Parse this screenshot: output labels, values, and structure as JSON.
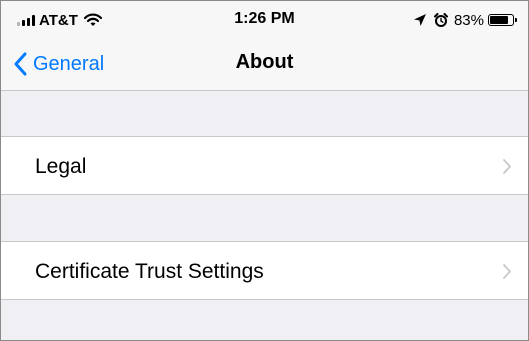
{
  "status_bar": {
    "carrier": "AT&T",
    "time": "1:26 PM",
    "battery_percent": "83%",
    "battery_level": 0.83,
    "icons": [
      "signal-icon",
      "wifi-icon",
      "location-arrow-icon",
      "alarm-icon",
      "battery-icon"
    ]
  },
  "nav": {
    "back_label": "General",
    "title": "About"
  },
  "rows": [
    {
      "label": "Legal"
    },
    {
      "label": "Certificate Trust Settings"
    }
  ],
  "colors": {
    "accent": "#007aff",
    "background": "#efeff4",
    "cell_background": "#ffffff",
    "separator": "#c8c7cc",
    "chevron": "#c7c7cc"
  }
}
